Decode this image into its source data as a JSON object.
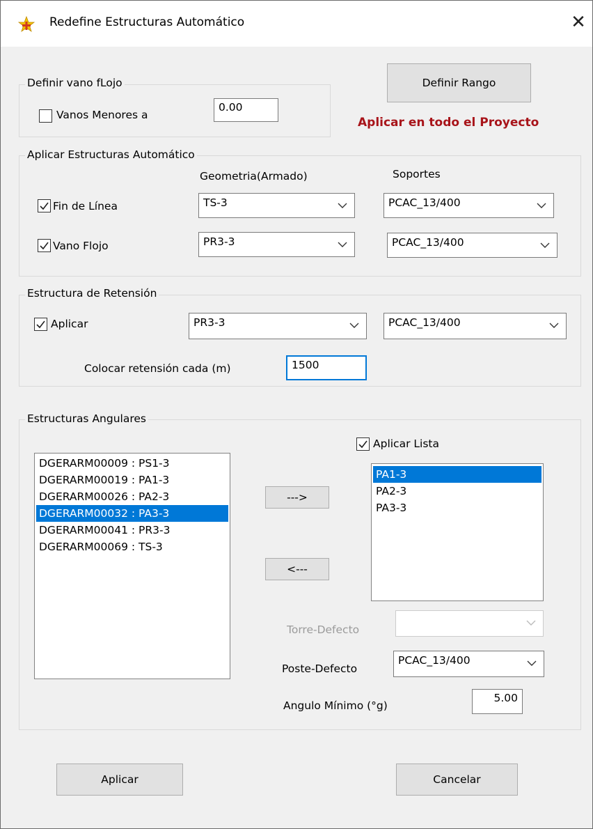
{
  "window": {
    "title": "Redefine Estructuras Automático",
    "close_glyph": "✕",
    "icon": "app-star-icon"
  },
  "vano_flojo": {
    "group_label": "Definir vano fLojo",
    "checkbox_label": "Vanos Menores a",
    "checked": false,
    "value": "0.00"
  },
  "definir_rango_label": "Definir Rango",
  "aplicar_proyecto_text": "Aplicar en todo el Proyecto",
  "automatico": {
    "group_label": "Aplicar Estructuras Automático",
    "col_geometria": "Geometria(Armado)",
    "col_soportes": "Soportes",
    "rows": [
      {
        "label": "Fin de Línea",
        "checked": true,
        "geometria": "TS-3",
        "soporte": "PCAC_13/400"
      },
      {
        "label": "Vano Flojo",
        "checked": true,
        "geometria": "PR3-3",
        "soporte": "PCAC_13/400"
      }
    ]
  },
  "retension": {
    "group_label": "Estructura de Retensión",
    "checkbox_label": "Aplicar",
    "checked": true,
    "geometria": "PR3-3",
    "soporte": "PCAC_13/400",
    "cada_label": "Colocar retensión cada (m)",
    "cada_value": "1500"
  },
  "angulares": {
    "group_label": "Estructuras Angulares",
    "available": [
      "DGERARM00009 : PS1-3",
      "DGERARM00019 : PA1-3",
      "DGERARM00026 : PA2-3",
      "DGERARM00032 : PA3-3",
      "DGERARM00041 : PR3-3",
      "DGERARM00069 : TS-3"
    ],
    "available_selected_index": 3,
    "add_label": "--->",
    "remove_label": "<---",
    "aplicar_lista_label": "Aplicar Lista",
    "aplicar_lista_checked": true,
    "selected_list": [
      "PA1-3",
      "PA2-3",
      "PA3-3"
    ],
    "selected_list_selected_index": 0,
    "torre_label": "Torre-Defecto",
    "torre_value": "",
    "poste_label": "Poste-Defecto",
    "poste_value": "PCAC_13/400",
    "angulo_label": "Angulo Mínimo (°g)",
    "angulo_value": "5.00"
  },
  "buttons": {
    "aplicar": "Aplicar",
    "cancelar": "Cancelar"
  },
  "colors": {
    "accent": "#0078d7",
    "warning_text": "#a8141a",
    "disabled_text": "#9b9b9b"
  }
}
